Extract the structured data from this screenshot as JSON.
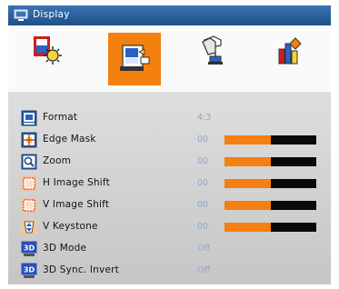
{
  "title": "Display",
  "accent_color": "#f4800e",
  "titlebar_color": "#2a5f9b",
  "top_icons": [
    {
      "name": "image-settings-icon",
      "selected": false
    },
    {
      "name": "display-settings-icon",
      "selected": true
    },
    {
      "name": "setup-icon",
      "selected": false
    },
    {
      "name": "options-icon",
      "selected": false
    }
  ],
  "rows": [
    {
      "label": "Format",
      "value": "4:3",
      "icon": "format-icon"
    },
    {
      "label": "Edge Mask",
      "value": "00",
      "icon": "edge-mask-icon",
      "level": 0.5
    },
    {
      "label": "Zoom",
      "value": "00",
      "icon": "zoom-icon",
      "level": 0.5
    },
    {
      "label": "H Image Shift",
      "value": "00",
      "icon": "h-image-shift-icon",
      "level": 0.5
    },
    {
      "label": "V Image Shift",
      "value": "00",
      "icon": "v-image-shift-icon",
      "level": 0.5
    },
    {
      "label": "V Keystone",
      "value": "00",
      "icon": "v-keystone-icon",
      "level": 0.5
    },
    {
      "label": "3D Mode",
      "value": "Off",
      "icon": "3d-mode-icon"
    },
    {
      "label": "3D Sync. Invert",
      "value": "Off",
      "icon": "3d-sync-invert-icon"
    }
  ]
}
